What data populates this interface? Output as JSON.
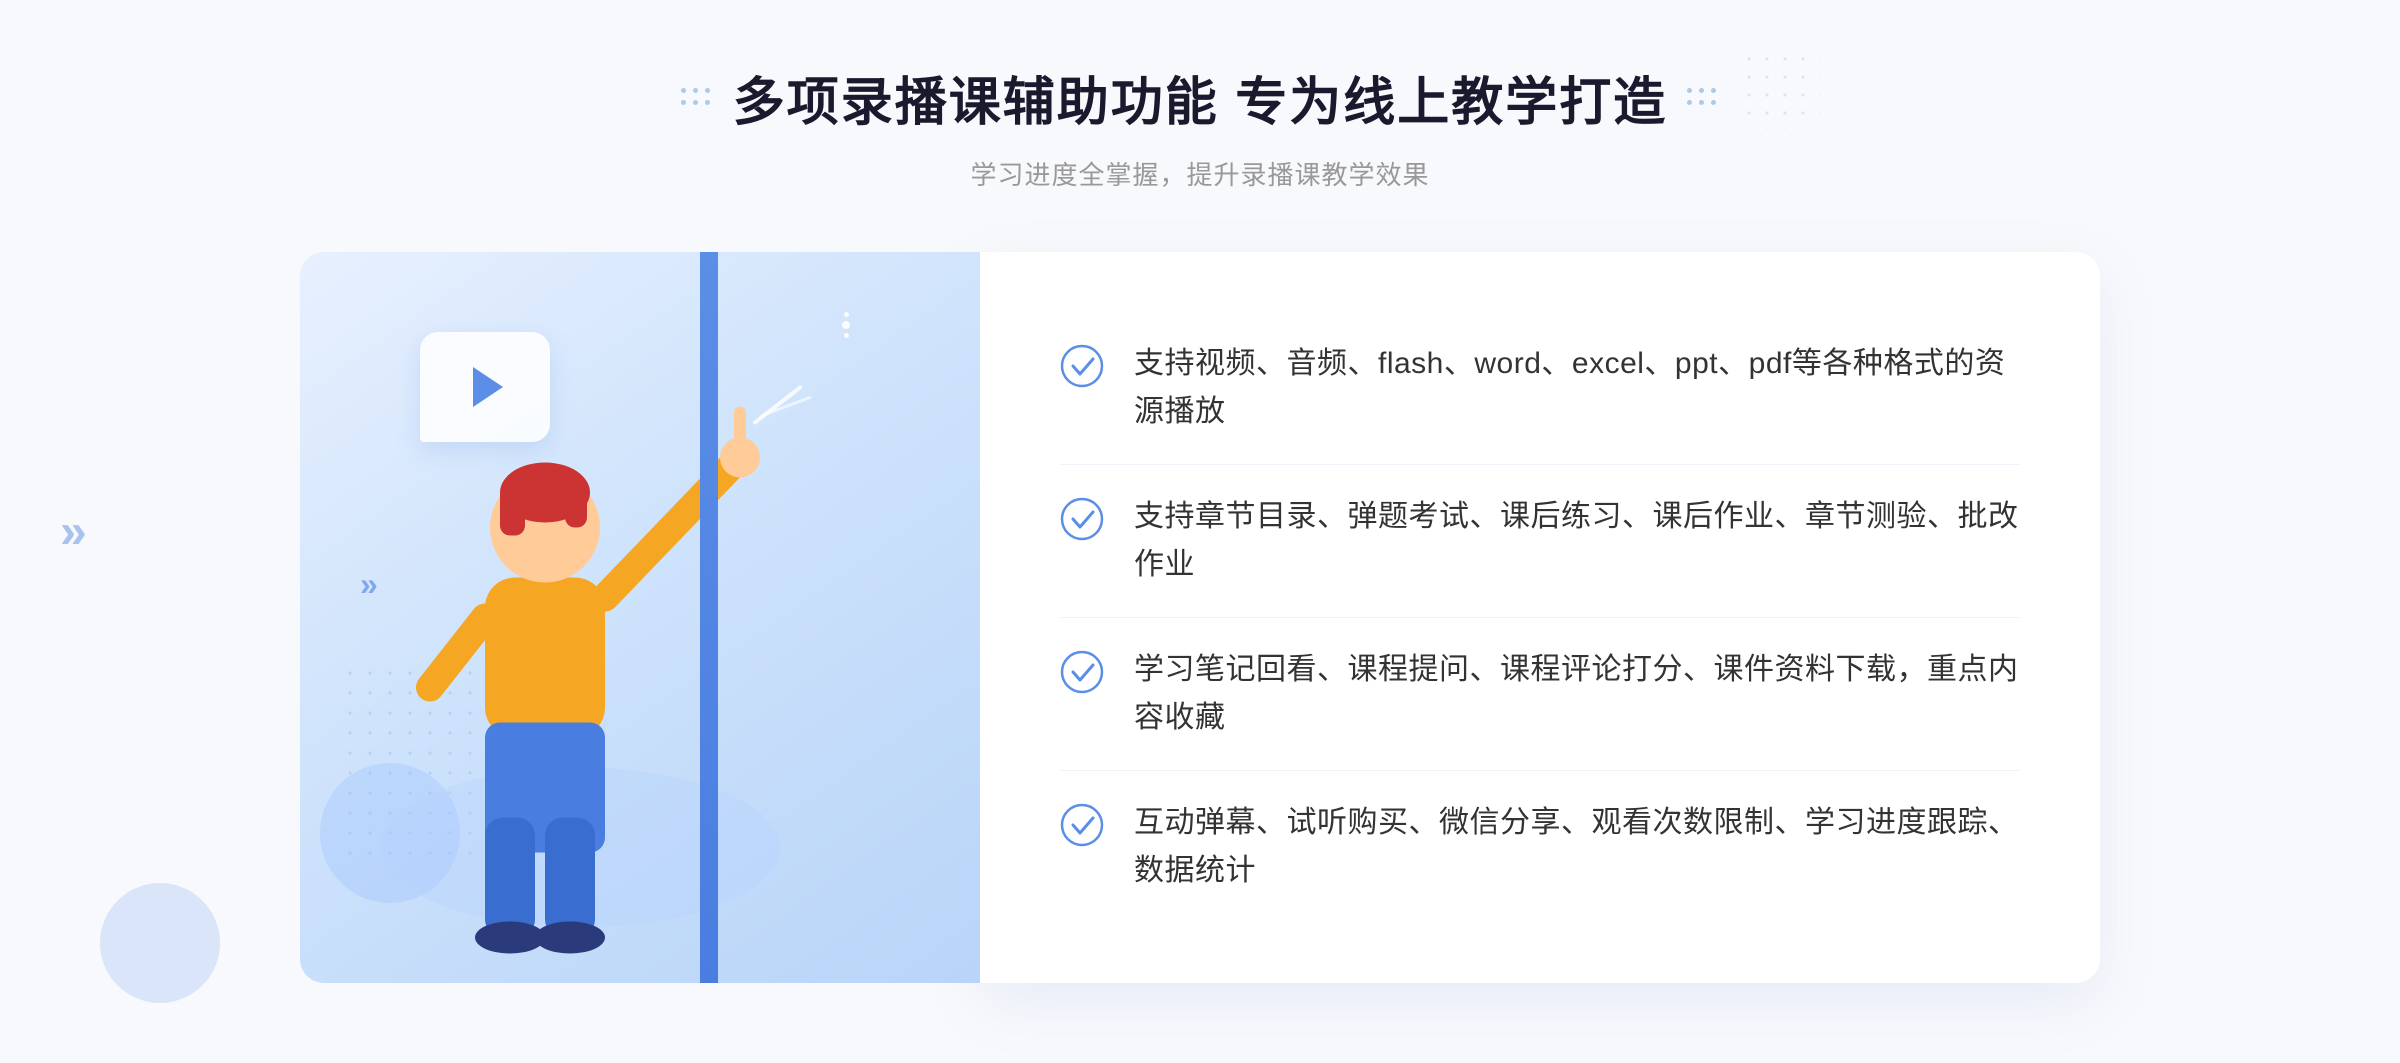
{
  "header": {
    "title": "多项录播课辅助功能 专为线上教学打造",
    "subtitle": "学习进度全掌握，提升录播课教学效果"
  },
  "features": [
    {
      "id": "feature-1",
      "text": "支持视频、音频、flash、word、excel、ppt、pdf等各种格式的资源播放"
    },
    {
      "id": "feature-2",
      "text": "支持章节目录、弹题考试、课后练习、课后作业、章节测验、批改作业"
    },
    {
      "id": "feature-3",
      "text": "学习笔记回看、课程提问、课程评论打分、课件资料下载，重点内容收藏"
    },
    {
      "id": "feature-4",
      "text": "互动弹幕、试听购买、微信分享、观看次数限制、学习进度跟踪、数据统计"
    }
  ],
  "colors": {
    "primary": "#4a7de0",
    "accent": "#5b8ee6",
    "light_blue": "#d0e4fc",
    "check_color": "#5b8ee6",
    "title_color": "#1a1a2e",
    "text_color": "#333333",
    "subtitle_color": "#999999"
  }
}
